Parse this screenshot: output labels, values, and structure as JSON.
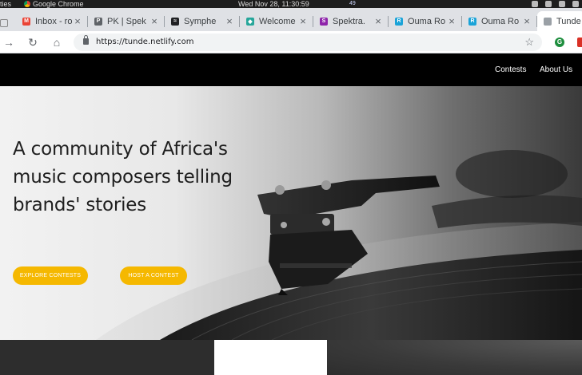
{
  "os_bar": {
    "activities": "ties",
    "app_name": "Google Chrome",
    "clock": "Wed Nov 28, 11:30:59",
    "indicator": "49"
  },
  "tabs": [
    {
      "title": "Inbox - ro",
      "icon": "gmail-icon",
      "color": "#ea4335",
      "glyph": "M"
    },
    {
      "title": "PK | Spek",
      "icon": "pk-icon",
      "color": "#5f6368",
      "glyph": "P"
    },
    {
      "title": "Symphe",
      "icon": "symphony-icon",
      "color": "#202124",
      "glyph": "≈"
    },
    {
      "title": "Welcome",
      "icon": "welcome-icon",
      "color": "#26a69a",
      "glyph": "◆"
    },
    {
      "title": "Spektra.",
      "icon": "spektra-icon",
      "color": "#8e24aa",
      "glyph": "S"
    },
    {
      "title": "Ouma Ro",
      "icon": "ouma-icon",
      "color": "#1aa3d8",
      "glyph": "R"
    },
    {
      "title": "Ouma Ro",
      "icon": "ouma-icon",
      "color": "#1aa3d8",
      "glyph": "R"
    },
    {
      "title": "Tunde T",
      "icon": "page-icon",
      "color": "#9aa0a6",
      "glyph": ""
    }
  ],
  "address_bar": {
    "url": "https://tunde.netlify.com"
  },
  "site_nav": {
    "contests": "Contests",
    "about": "About Us"
  },
  "hero": {
    "title": "A community of Africa's music composers telling brands' stories",
    "explore_button": "EXPLORE CONTESTS",
    "host_button": "HOST A CONTEST",
    "accent_color": "#f5b800"
  }
}
